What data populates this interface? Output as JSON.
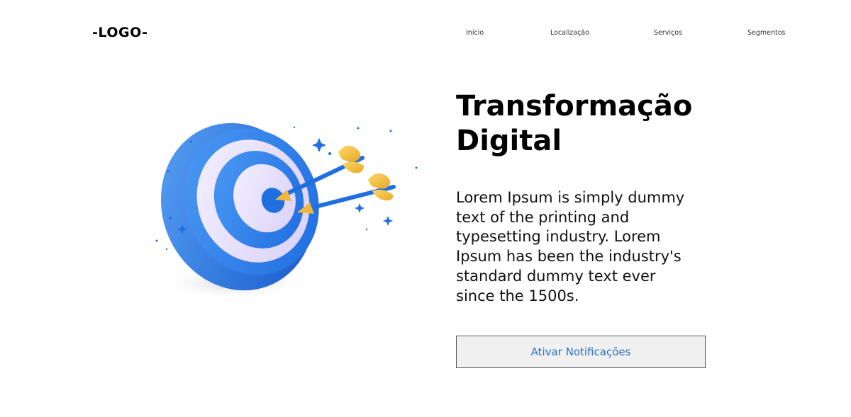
{
  "header": {
    "logo": "-LOGO-",
    "nav": [
      {
        "label": "Início"
      },
      {
        "label": "Localização"
      },
      {
        "label": "Serviços"
      },
      {
        "label": "Segmentos"
      }
    ]
  },
  "hero": {
    "title_line1": "Transformação",
    "title_line2": "Digital",
    "description": "Lorem Ipsum is simply dummy text of the printing and typesetting industry. Lorem Ipsum has been the industry's standard dummy text ever since the 1500s.",
    "cta_label": "Ativar Notificações",
    "image_icon": "target-with-arrows-icon"
  },
  "colors": {
    "accent_blue": "#1f6fe0",
    "light_ring": "#e9e3fb",
    "arrow_fletch": "#f5c542",
    "cta_text": "#2d6fc4"
  }
}
